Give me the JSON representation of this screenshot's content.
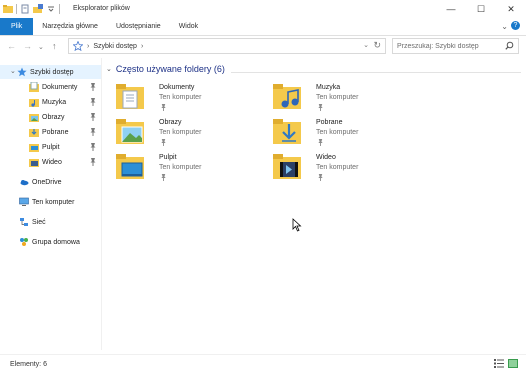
{
  "window": {
    "title": "Eksplorator plików",
    "controls": {
      "minimize": "—",
      "maximize": "☐",
      "close": "✕"
    }
  },
  "ribbon": {
    "tabs": [
      {
        "label": "Plik",
        "active": true
      },
      {
        "label": "Narzędzia główne"
      },
      {
        "label": "Udostępnianie"
      },
      {
        "label": "Widok"
      }
    ]
  },
  "address": {
    "current": "Szybki dostęp",
    "search_placeholder": "Przeszukaj: Szybki dostęp"
  },
  "nav": {
    "quick_access": "Szybki dostęp",
    "pinned": [
      {
        "label": "Dokumenty",
        "icon": "documents-icon"
      },
      {
        "label": "Muzyka",
        "icon": "music-icon"
      },
      {
        "label": "Obrazy",
        "icon": "pictures-icon"
      },
      {
        "label": "Pobrane",
        "icon": "downloads-icon"
      },
      {
        "label": "Pulpit",
        "icon": "desktop-icon"
      },
      {
        "label": "Wideo",
        "icon": "videos-icon"
      }
    ],
    "onedrive": "OneDrive",
    "this_pc": "Ten komputer",
    "network": "Sieć",
    "homegroup": "Grupa domowa"
  },
  "content": {
    "group_title": "Często używane foldery (6)",
    "folders": [
      {
        "name": "Dokumenty",
        "location": "Ten komputer",
        "icon": "documents-folder-icon"
      },
      {
        "name": "Muzyka",
        "location": "Ten komputer",
        "icon": "music-folder-icon"
      },
      {
        "name": "Obrazy",
        "location": "Ten komputer",
        "icon": "pictures-folder-icon"
      },
      {
        "name": "Pobrane",
        "location": "Ten komputer",
        "icon": "downloads-folder-icon"
      },
      {
        "name": "Pulpit",
        "location": "Ten komputer",
        "icon": "desktop-folder-icon"
      },
      {
        "name": "Wideo",
        "location": "Ten komputer",
        "icon": "videos-folder-icon"
      }
    ]
  },
  "status": {
    "items_count": "Elementy: 6"
  },
  "colors": {
    "accent": "#1979ca",
    "folder": "#f4c94b",
    "group_title": "#1e3287",
    "selection": "#e5f3ff"
  }
}
